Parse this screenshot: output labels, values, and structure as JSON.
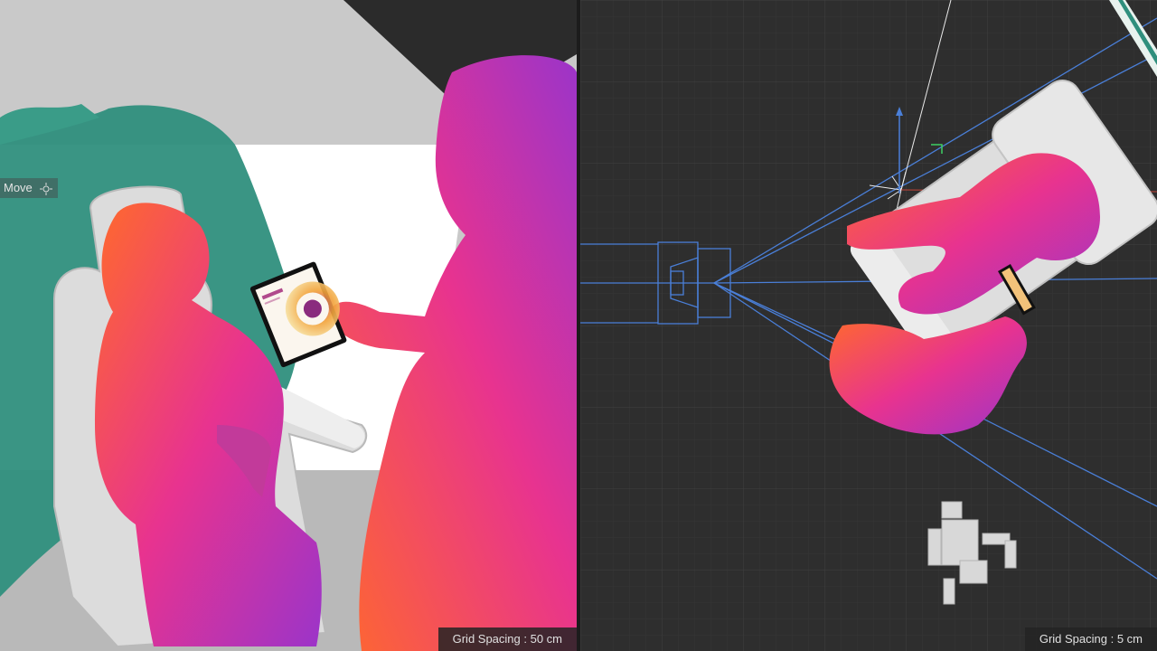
{
  "left_viewport": {
    "hud_label": "Move",
    "hud_icon": "move-crosshair-icon",
    "grid_spacing": "Grid Spacing : 50 cm"
  },
  "right_viewport": {
    "grid_spacing": "Grid Spacing : 5 cm"
  },
  "colors": {
    "figure_gradient": [
      "#ff6a2b",
      "#e8338f",
      "#9b34c9"
    ],
    "paint_green": "#2f8f7d",
    "camera_wire": "#4a7fd8",
    "grid_line": "#3a3a3a",
    "backdrop": "#ffffff"
  }
}
